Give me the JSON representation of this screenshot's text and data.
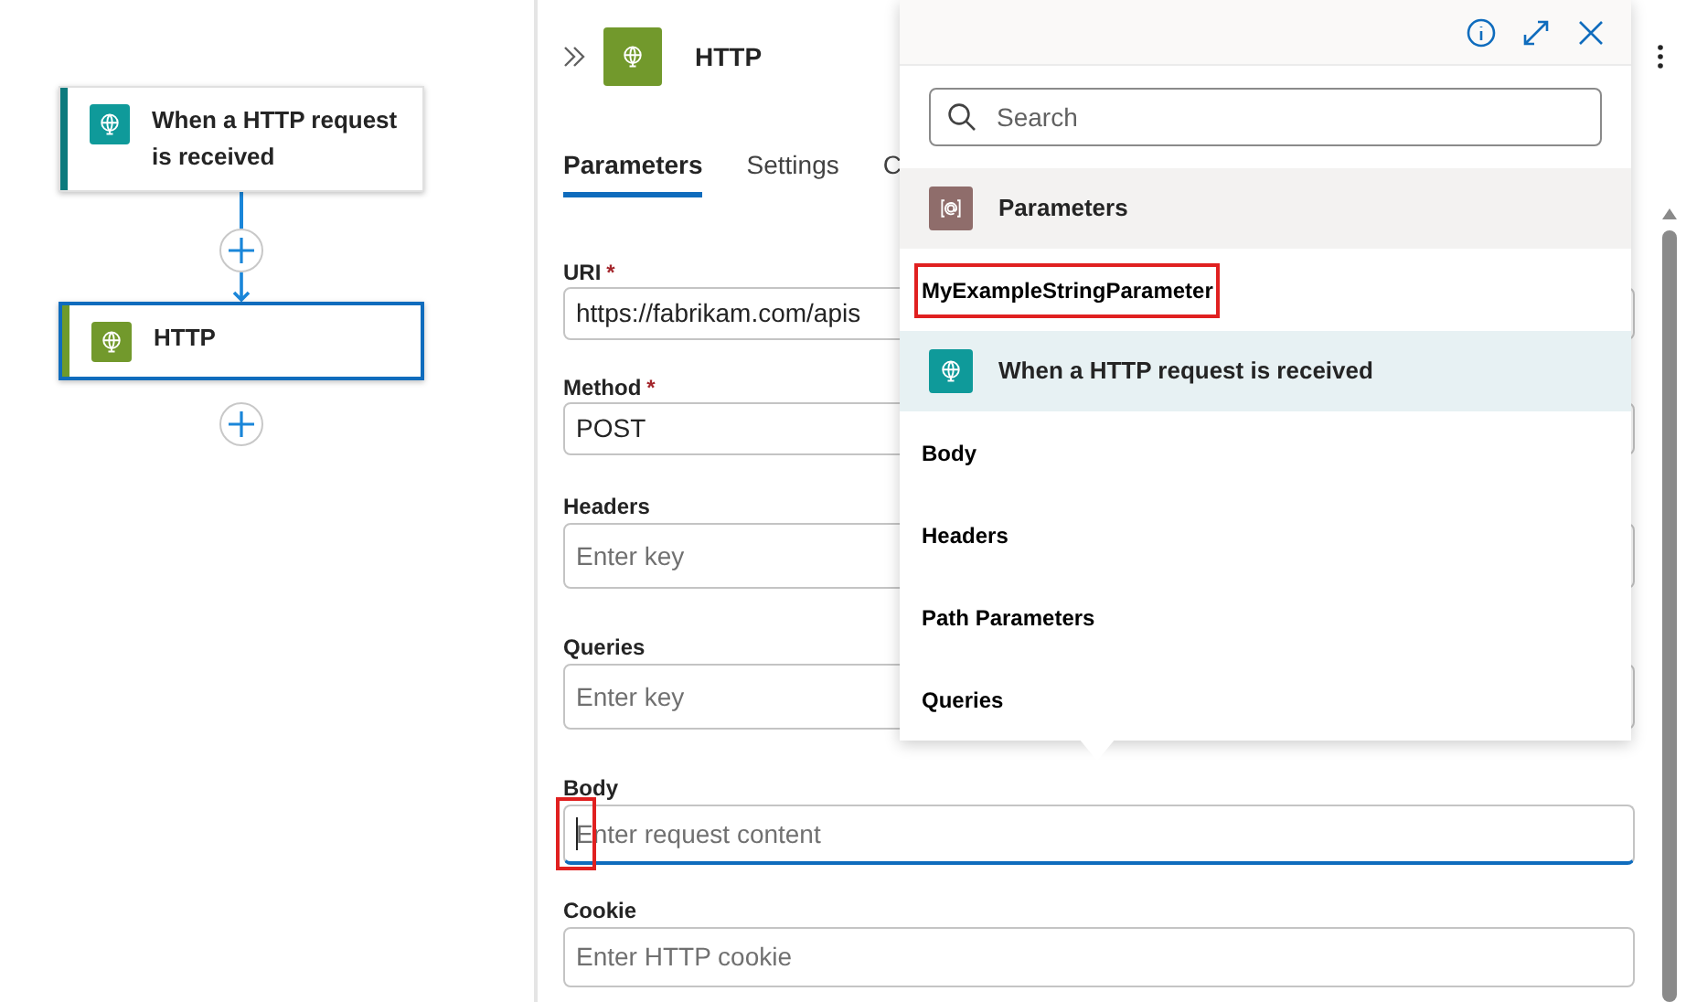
{
  "canvas": {
    "nodes": [
      {
        "title": "When a HTTP request is received",
        "kind": "trigger",
        "selected": false
      },
      {
        "title": "HTTP",
        "kind": "action",
        "selected": true
      }
    ]
  },
  "panel": {
    "title": "HTTP",
    "tabs": [
      {
        "label": "Parameters",
        "selected": true
      },
      {
        "label": "Settings",
        "selected": false
      },
      {
        "label": "C",
        "selected": false
      }
    ],
    "fields": [
      {
        "label": "URI",
        "mark": "*",
        "value": "https://fabrikam.com/apis"
      },
      {
        "label": "Method",
        "mark": "*",
        "value": "POST"
      },
      {
        "label": "Headers",
        "placeholder": "Enter key"
      },
      {
        "label": "Queries",
        "placeholder": "Enter key"
      },
      {
        "label": "Body",
        "placeholder": "Enter request content",
        "focused": true,
        "highlighted": true
      },
      {
        "label": "Cookie",
        "placeholder": "Enter HTTP cookie"
      }
    ]
  },
  "token_picker": {
    "search": {
      "placeholder": "Search"
    },
    "sections": [
      {
        "title": "Parameters",
        "kind": "parameters",
        "items": [
          {
            "label": "MyExampleStringParameter",
            "highlighted": true
          }
        ]
      },
      {
        "title": "When a HTTP request is received",
        "kind": "trigger",
        "items": [
          {
            "label": "Body",
            "highlighted": false
          },
          {
            "label": "Headers",
            "highlighted": false
          },
          {
            "label": "Path Parameters",
            "highlighted": false
          },
          {
            "label": "Queries",
            "highlighted": false
          }
        ]
      }
    ]
  }
}
